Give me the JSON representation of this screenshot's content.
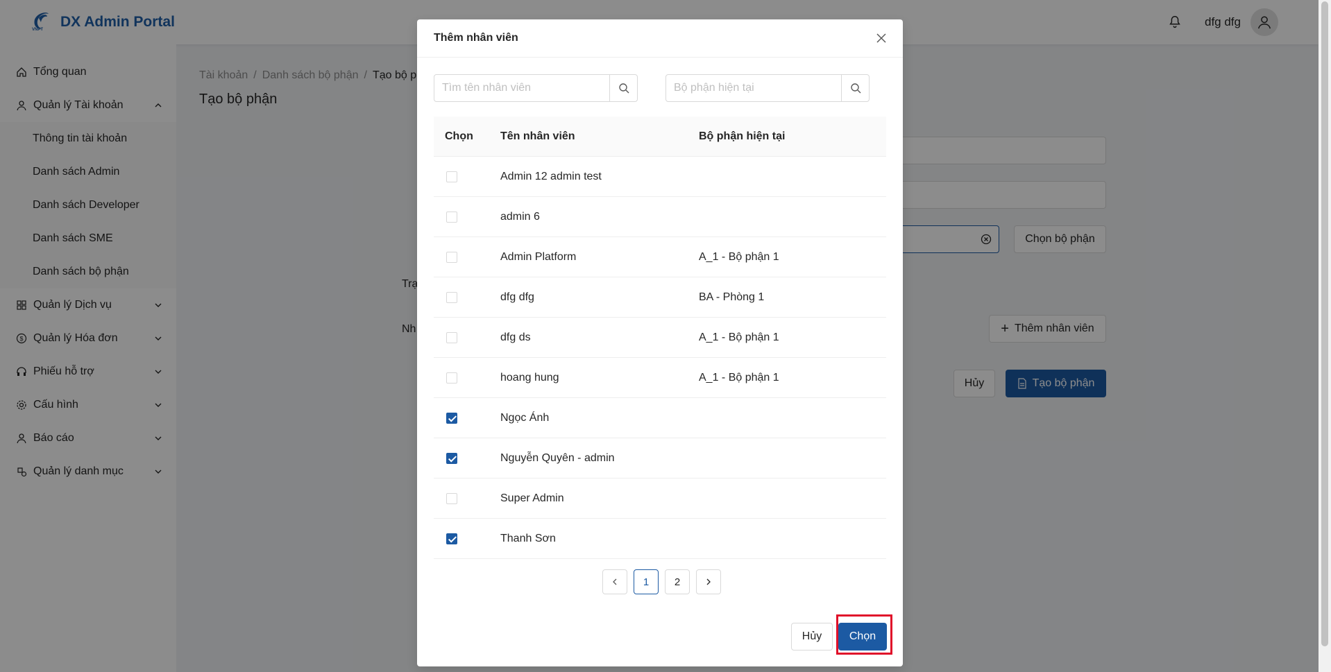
{
  "header": {
    "logo_text": "VNPT",
    "brand": "DX Admin Portal",
    "user_name": "dfg dfg"
  },
  "sidebar": {
    "items": [
      {
        "label": "Tổng quan",
        "icon": "home-icon"
      },
      {
        "label": "Quản lý Tài khoản",
        "icon": "user-icon",
        "expanded": true
      },
      {
        "label": "Quản lý Dịch vụ",
        "icon": "grid-icon"
      },
      {
        "label": "Quản lý Hóa đơn",
        "icon": "dollar-icon"
      },
      {
        "label": "Phiếu hỗ trợ",
        "icon": "headset-icon"
      },
      {
        "label": "Cấu hình",
        "icon": "gear-icon"
      },
      {
        "label": "Báo cáo",
        "icon": "user-icon"
      },
      {
        "label": "Quản lý danh mục",
        "icon": "category-icon"
      }
    ],
    "sub_items": [
      {
        "label": "Thông tin tài khoản"
      },
      {
        "label": "Danh sách Admin"
      },
      {
        "label": "Danh sách Developer"
      },
      {
        "label": "Danh sách SME"
      },
      {
        "label": "Danh sách bộ phận"
      }
    ]
  },
  "page": {
    "breadcrumb": [
      "Tài khoản",
      "Danh sách bộ phận",
      "Tạo bộ ph"
    ],
    "title": "Tạo bộ phận",
    "label_status": "Trạ",
    "label_staff": "Nh",
    "choose_dept_label": "Chọn bộ phận",
    "add_staff_label": "Thêm nhân viên",
    "cancel_label": "Hủy",
    "create_label": "Tạo bộ phận"
  },
  "modal": {
    "title": "Thêm nhân viên",
    "search_name_placeholder": "Tìm tên nhân viên",
    "search_dept_placeholder": "Bộ phận hiện tại",
    "columns": [
      "Chọn",
      "Tên nhân viên",
      "Bộ phận hiện tại"
    ],
    "rows": [
      {
        "name": "Admin 12 admin test",
        "dept": "",
        "checked": false
      },
      {
        "name": "admin 6",
        "dept": "",
        "checked": false
      },
      {
        "name": "Admin Platform",
        "dept": "A_1 - Bộ phận 1",
        "checked": false
      },
      {
        "name": "dfg dfg",
        "dept": "BA - Phòng 1",
        "checked": false
      },
      {
        "name": "dfg ds",
        "dept": "A_1 - Bộ phận 1",
        "checked": false
      },
      {
        "name": "hoang hung",
        "dept": "A_1 - Bộ phận 1",
        "checked": false
      },
      {
        "name": "Ngọc Ánh",
        "dept": "",
        "checked": true
      },
      {
        "name": "Nguyễn Quyên - admin",
        "dept": "",
        "checked": true
      },
      {
        "name": "Super Admin",
        "dept": "",
        "checked": false
      },
      {
        "name": "Thanh Sơn",
        "dept": "",
        "checked": true
      }
    ],
    "pagination": {
      "pages": [
        "1",
        "2"
      ],
      "current": "1"
    },
    "cancel_label": "Hủy",
    "ok_label": "Chọn"
  },
  "colors": {
    "primary": "#1c5aa3",
    "highlight": "#e0102a"
  }
}
